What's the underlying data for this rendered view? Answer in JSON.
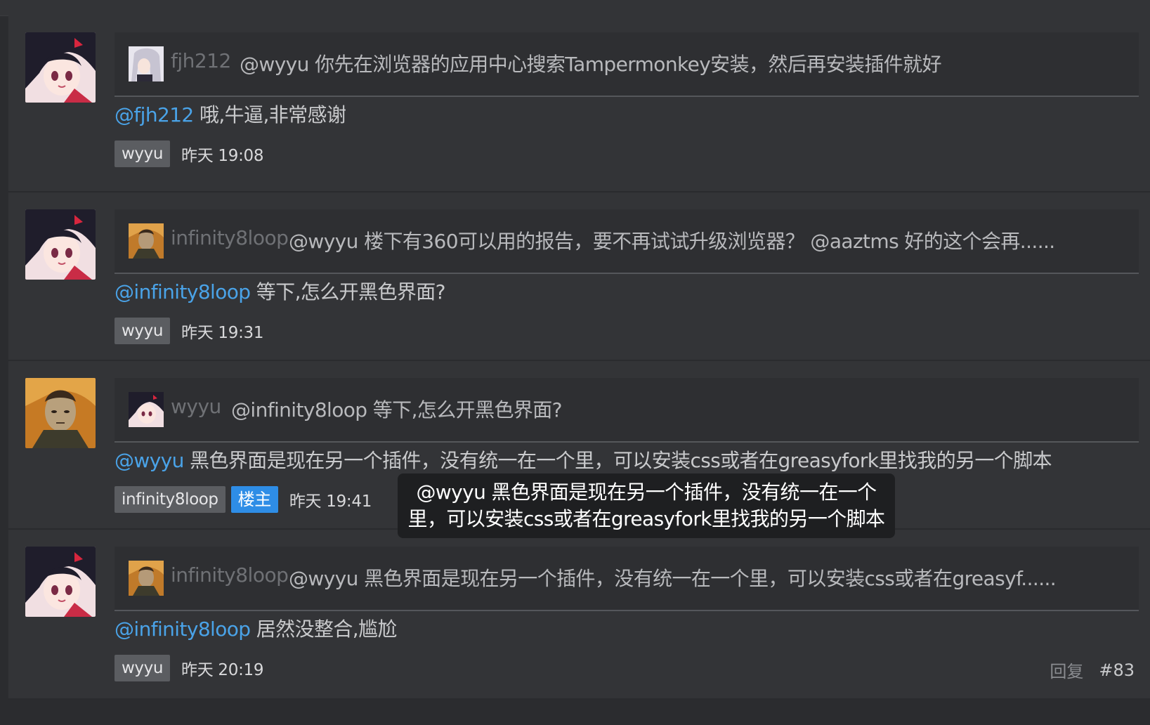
{
  "comments": [
    {
      "avatar_icon": "anime-girl-avatar",
      "quote_avatar_icon": "anime-girl-silver-avatar",
      "quote_user": "fjh212",
      "quote_text": "@wyyu 你先在浏览器的应用中心搜索Tampermonkey安装，然后再安装插件就好",
      "reply_mention": "@fjh212",
      "reply_text": " 哦,牛逼,非常感谢",
      "author": "wyyu",
      "time": "昨天 19:08"
    },
    {
      "avatar_icon": "anime-girl-avatar",
      "quote_avatar_icon": "dark-man-avatar",
      "quote_user": "infinity8loop",
      "quote_text": "@wyyu 楼下有360可以用的报告，要不再试试升级浏览器？ @aaztms 好的这个会再......",
      "reply_mention": "@infinity8loop",
      "reply_text": " 等下,怎么开黑色界面?",
      "author": "wyyu",
      "time": "昨天 19:31"
    },
    {
      "avatar_icon": "dark-man-avatar",
      "quote_avatar_icon": "anime-girl-avatar",
      "quote_user": "wyyu",
      "quote_text": "@infinity8loop 等下,怎么开黑色界面?",
      "reply_mention": "@wyyu",
      "reply_text": " 黑色界面是现在另一个插件，没有统一在一个里，可以安装css或者在greasyfork里找我的另一个脚本",
      "author": "infinity8loop",
      "owner_badge": "楼主",
      "time": "昨天 19:41"
    },
    {
      "avatar_icon": "anime-girl-avatar",
      "quote_avatar_icon": "dark-man-avatar",
      "quote_user": "infinity8loop",
      "quote_text": "@wyyu 黑色界面是现在另一个插件，没有统一在一个里，可以安装css或者在greasyf......",
      "reply_mention": "@infinity8loop",
      "reply_text": " 居然没整合,尴尬",
      "author": "wyyu",
      "time": "昨天 20:19",
      "reply_action": "回复",
      "floor": "#83"
    }
  ],
  "tooltip": {
    "line1": "@wyyu 黑色界面是现在另一个插件，没有统一在一个",
    "line2": "里，可以安装css或者在greasyfork里找我的另一个脚本"
  },
  "colors": {
    "background": "#2b2c2f",
    "card": "#333437",
    "mention": "#4aa3e8",
    "owner_badge": "#2e8de6",
    "tag": "#5b5d61"
  }
}
